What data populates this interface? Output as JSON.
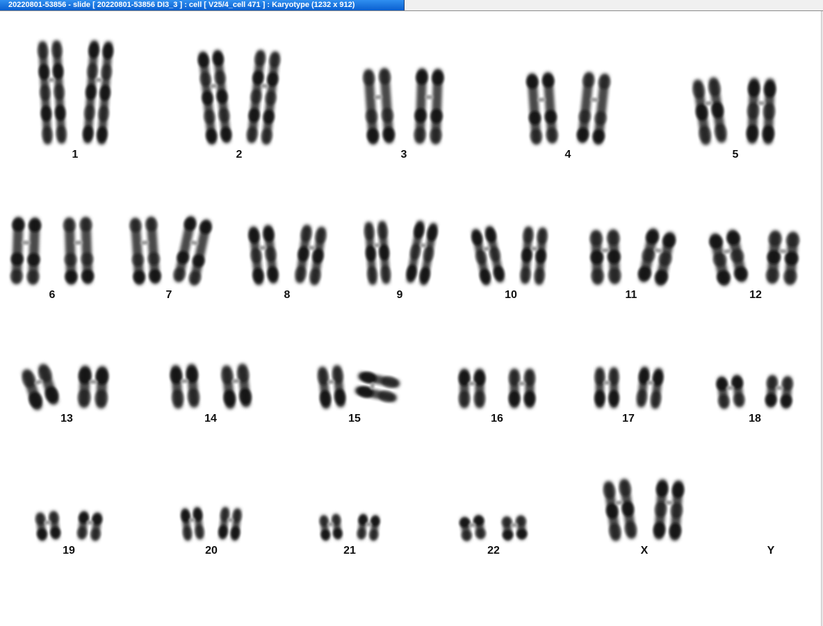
{
  "window": {
    "title": "20220801-53856 - slide [ 20220801-53856 DI3_3 ] : cell [ V25/4_cell 471 ] : Karyotype  (1232 x 912)"
  },
  "karyotype": {
    "pairs": [
      {
        "label": "1",
        "present": true
      },
      {
        "label": "2",
        "present": true
      },
      {
        "label": "3",
        "present": true
      },
      {
        "label": "4",
        "present": true
      },
      {
        "label": "5",
        "present": true
      },
      {
        "label": "6",
        "present": true
      },
      {
        "label": "7",
        "present": true
      },
      {
        "label": "8",
        "present": true
      },
      {
        "label": "9",
        "present": true
      },
      {
        "label": "10",
        "present": true
      },
      {
        "label": "11",
        "present": true
      },
      {
        "label": "12",
        "present": true
      },
      {
        "label": "13",
        "present": true
      },
      {
        "label": "14",
        "present": true
      },
      {
        "label": "15",
        "present": true
      },
      {
        "label": "16",
        "present": true
      },
      {
        "label": "17",
        "present": true
      },
      {
        "label": "18",
        "present": true
      },
      {
        "label": "19",
        "present": true
      },
      {
        "label": "20",
        "present": true
      },
      {
        "label": "21",
        "present": true
      },
      {
        "label": "22",
        "present": true
      },
      {
        "label": "X",
        "present": true
      },
      {
        "label": "Y",
        "present": false
      }
    ]
  }
}
